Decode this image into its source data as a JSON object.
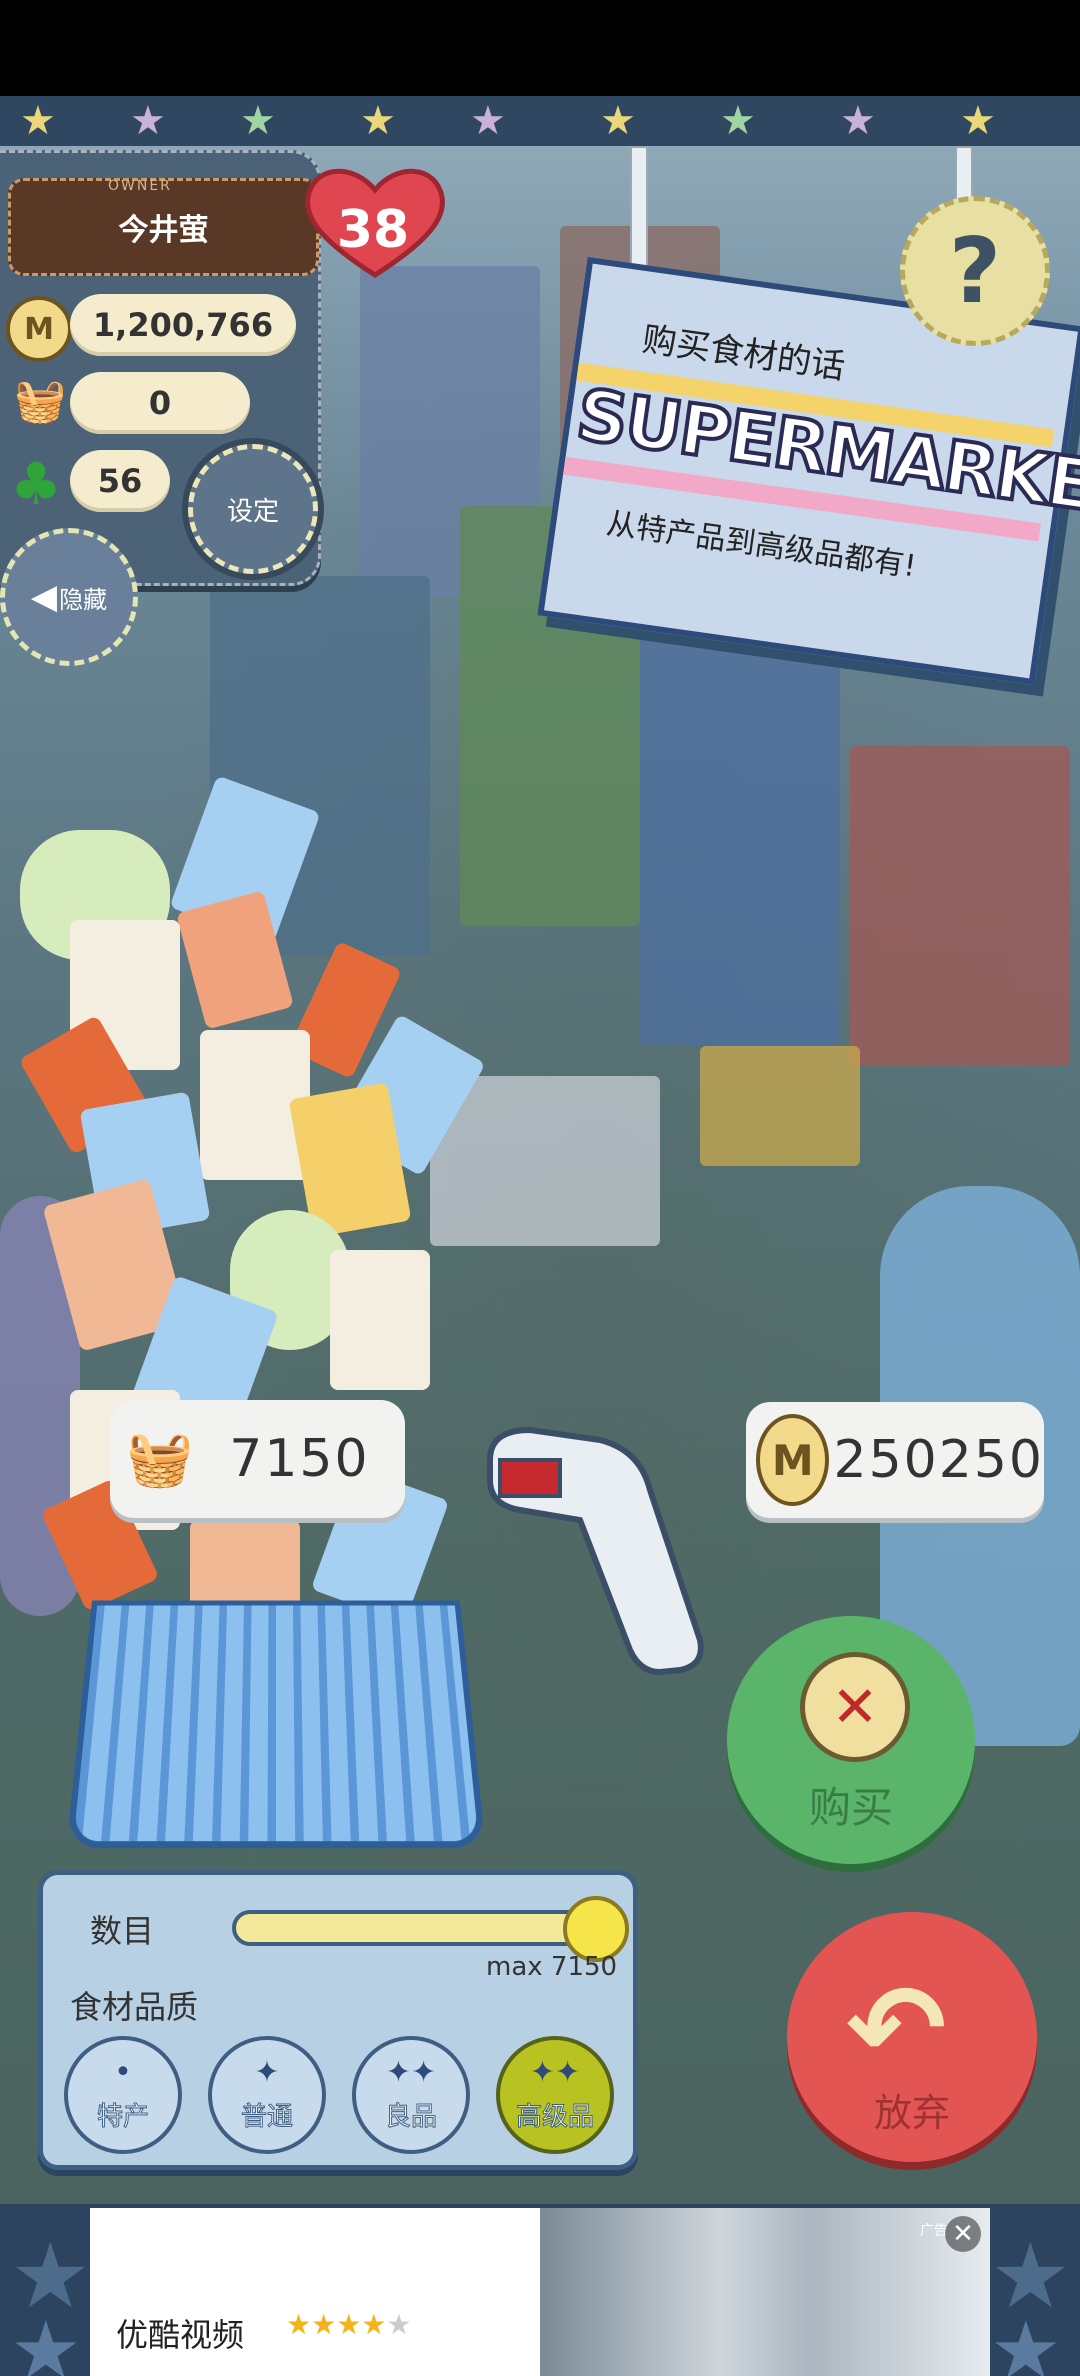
{
  "owner": {
    "tag": "OWNER",
    "name": "今井萤",
    "level": "38"
  },
  "stats": {
    "money": "1,200,766",
    "ingredients": "0",
    "clover": "56"
  },
  "buttons": {
    "settings": "设定",
    "hide": "隐藏",
    "help": "?",
    "buy": "购买",
    "quit": "放弃"
  },
  "sign": {
    "top_text": "购买食材的话",
    "title": "SUPERMARKET",
    "subtitle": "从特产品到高级品都有!"
  },
  "purchase": {
    "quantity_bubble": "7150",
    "price_bubble": "250250",
    "coin_symbol": "M"
  },
  "quantity": {
    "label": "数目",
    "max_label": "max 7150",
    "fraction": 1.0
  },
  "quality": {
    "label": "食材品质",
    "options": [
      {
        "icon": "•",
        "label": "特产",
        "active": false
      },
      {
        "icon": "✦",
        "label": "普通",
        "active": false
      },
      {
        "icon": "✦✦",
        "label": "良品",
        "active": false
      },
      {
        "icon": "✦✦",
        "label": "高级品",
        "active": true
      }
    ]
  },
  "ad": {
    "title": "优酷视频",
    "tag": "广告",
    "close": "✕"
  },
  "colors": {
    "buy": "#5ab56b",
    "quit": "#e35552",
    "panel": "#b7d0e3",
    "accent_active": "#b8c220"
  }
}
